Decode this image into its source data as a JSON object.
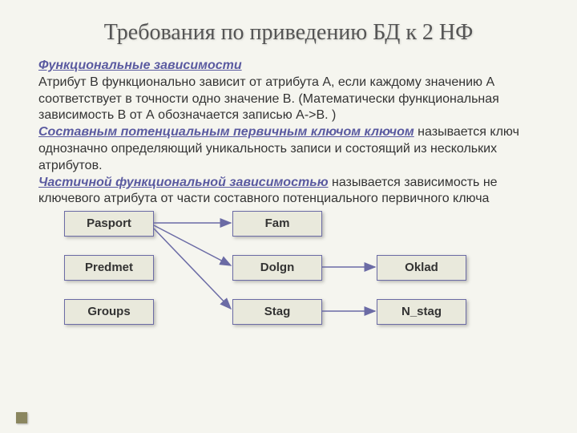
{
  "title": "Требования по приведению БД к 2 НФ",
  "text": {
    "h1": "Функциональные зависимости",
    "p1": "Атрибут В функционально зависит от атрибута А, если каждому значению А соответствует в точности одно значение В. (Математически функциональная зависимость В от А обозначается записью А->В. )",
    "h2": "Составным потенциальным первичным ключом ключом",
    "p2": " называется ключ однозначно определяющий уникальность записи и состоящий из нескольких атрибутов.",
    "h3": "Частичной функциональной зависимостью",
    "p3": " называется зависимость не ключевого атрибута от части составного потенциального первичного  ключа"
  },
  "nodes": {
    "pasport": "Pasport",
    "predmet": "Predmet",
    "groups": "Groups",
    "fam": "Fam",
    "dolgn": "Dolgn",
    "stag": "Stag",
    "oklad": "Oklad",
    "nstag": "N_stag"
  },
  "edges": [
    [
      "pasport",
      "fam"
    ],
    [
      "pasport",
      "dolgn"
    ],
    [
      "pasport",
      "stag"
    ],
    [
      "dolgn",
      "oklad"
    ],
    [
      "stag",
      "nstag"
    ]
  ]
}
